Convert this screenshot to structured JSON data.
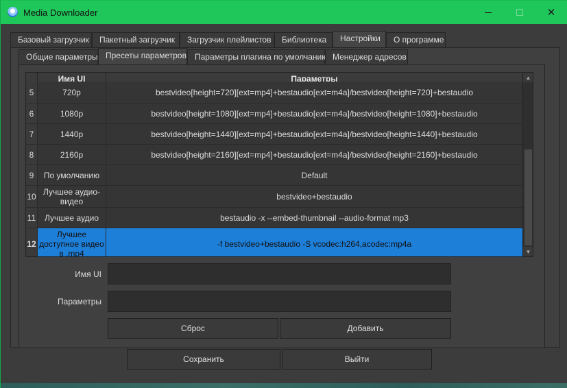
{
  "window": {
    "title": "Media Downloader",
    "accent": "#1fc65a",
    "selection_color": "#1e7fd8"
  },
  "main_tabs": [
    {
      "label": "Базовый загрузчик"
    },
    {
      "label": "Пакетный загрузчик"
    },
    {
      "label": "Загрузчик плейлистов"
    },
    {
      "label": "Библиотека"
    },
    {
      "label": "Настройки"
    },
    {
      "label": "О программе"
    }
  ],
  "sub_tabs": [
    {
      "label": "Общие параметры"
    },
    {
      "label": "Пресеты параметров"
    },
    {
      "label": "Параметры плагина по умолчанию"
    },
    {
      "label": "Менеджер адресов"
    }
  ],
  "table": {
    "headers": {
      "name": "Имя UI",
      "params": "Параметры"
    },
    "rows": [
      {
        "num": "5",
        "name": "720p",
        "params": "bestvideo[height=720][ext=mp4]+bestaudio[ext=m4a]/bestvideo[height=720]+bestaudio"
      },
      {
        "num": "6",
        "name": "1080p",
        "params": "bestvideo[height=1080][ext=mp4]+bestaudio[ext=m4a]/bestvideo[height=1080]+bestaudio"
      },
      {
        "num": "7",
        "name": "1440p",
        "params": "bestvideo[height=1440][ext=mp4]+bestaudio[ext=m4a]/bestvideo[height=1440]+bestaudio"
      },
      {
        "num": "8",
        "name": "2160p",
        "params": "bestvideo[height=2160][ext=mp4]+bestaudio[ext=m4a]/bestvideo[height=2160]+bestaudio"
      },
      {
        "num": "9",
        "name": "По умолчанию",
        "params": "Default"
      },
      {
        "num": "10",
        "name": "Лучшее аудио-видео",
        "params": "bestvideo+bestaudio"
      },
      {
        "num": "11",
        "name": "Лучшее аудио",
        "params": "bestaudio -x --embed-thumbnail --audio-format mp3"
      },
      {
        "num": "12",
        "name": "Лучшее доступное видео в .mp4",
        "params": "-f bestvideo+bestaudio -S vcodec:h264,acodec:mp4a"
      }
    ]
  },
  "form": {
    "name_label": "Имя UI",
    "name_value": "",
    "params_label": "Параметры",
    "params_value": "",
    "reset_label": "Сброс",
    "add_label": "Добавить"
  },
  "footer": {
    "save_label": "Сохранить",
    "exit_label": "Выйти"
  }
}
